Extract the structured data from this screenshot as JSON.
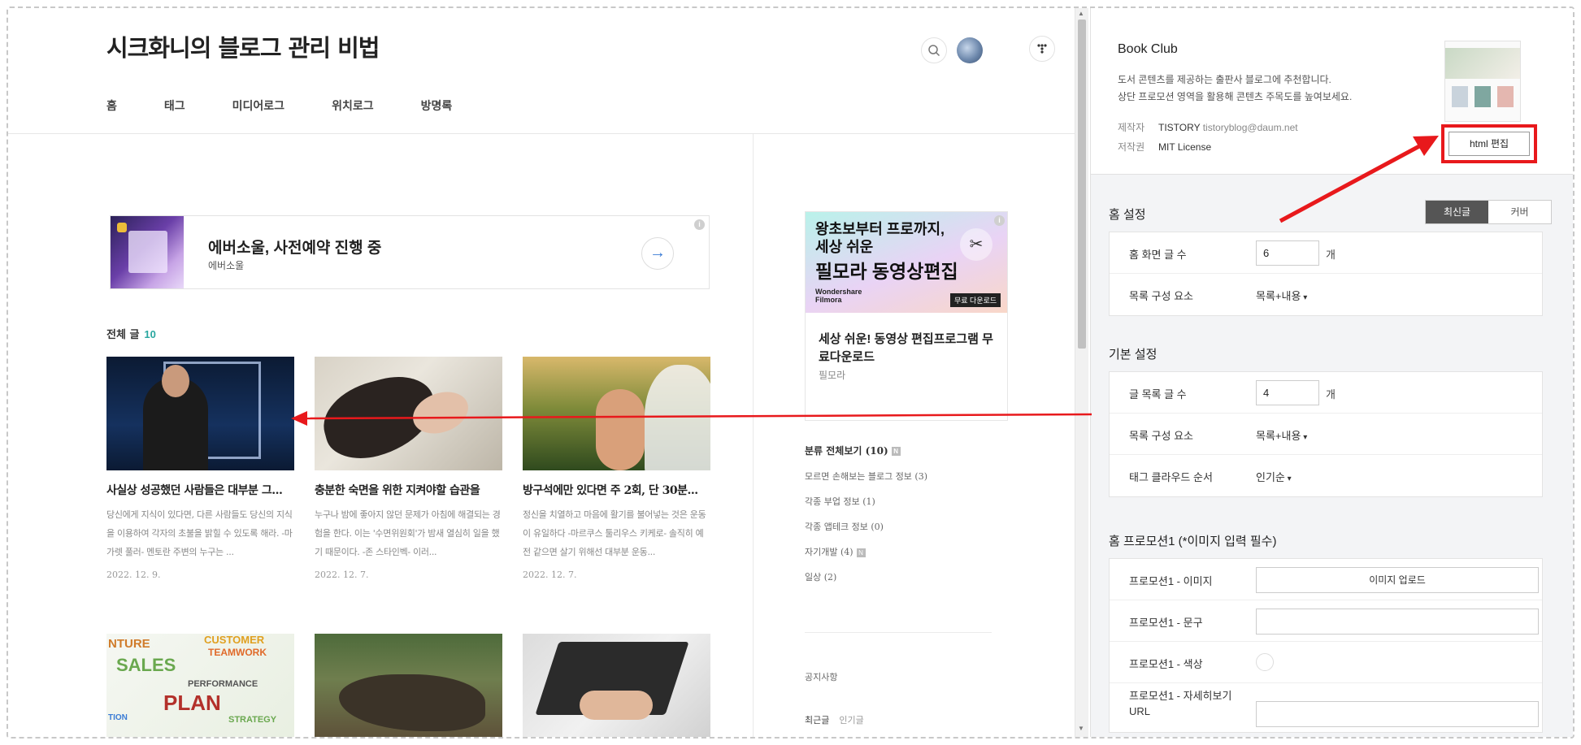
{
  "blog": {
    "title": "시크화니의 블로그 관리 비법",
    "nav": [
      "홈",
      "태그",
      "미디어로그",
      "위치로그",
      "방명록"
    ]
  },
  "banner_ad": {
    "title": "에버소울, 사전예약 진행 중",
    "subtitle": "에버소울",
    "info": "i",
    "go": "→"
  },
  "posts_header": {
    "label": "전체 글",
    "count": "10"
  },
  "posts": [
    {
      "title": "사실상 성공했던 사람들은 대부분 그...",
      "excerpt": "당신에게 지식이 있다면, 다른 사람들도 당신의 지식을 이용하여 각자의 초불을 밝힐 수 있도록 해라. -마가렛 풀러- 멘토란 주변의 누구는 ...",
      "date": "2022. 12. 9."
    },
    {
      "title": "충분한 숙면을 위한 지켜야할 습관을",
      "excerpt": "누구나 밤에 좋아지 않던 문제가 아침에 해결되는 경험을 한다. 이는 '수면위원회'가 밤새 열심히 일을 했기 때문이다. -존 스타인벡- 이러...",
      "date": "2022. 12. 7."
    },
    {
      "title": "방구석에만 있다면 주 2회, 단 30분...",
      "excerpt": "정신을 치열하고 마음에 활기를 불어넣는 것은 운동이 유일하다 -마르쿠스 툴리우스 키케로- 솔직히 예전 같으면 살기 위해선 대부분 운동...",
      "date": "2022. 12. 7."
    },
    {
      "title": "",
      "excerpt": "",
      "date": ""
    },
    {
      "title": "",
      "excerpt": "",
      "date": ""
    },
    {
      "title": "",
      "excerpt": "",
      "date": ""
    }
  ],
  "sidebar_ad": {
    "line1": "왕초보부터 프로까지,",
    "line2": "세상 쉬운",
    "line3": "필모라 동영상편집",
    "logo": "Wondershare\nFilmora",
    "download": "무료 다운로드",
    "caption": "세상 쉬운! 동영상 편집프로그램 무료다운로드",
    "source": "필모라"
  },
  "categories": {
    "head": "분류 전체보기 (10)",
    "new_badge": "N",
    "items": [
      {
        "label": "모르면 손해보는 블로그 정보 (3)",
        "new": false
      },
      {
        "label": "각종 부업 정보 (1)",
        "new": false
      },
      {
        "label": "각종 앱테크 정보 (0)",
        "new": false
      },
      {
        "label": "자기개발 (4)",
        "new": true
      },
      {
        "label": "일상 (2)",
        "new": false
      }
    ]
  },
  "notice": "공지사항",
  "recent_tabs": {
    "recent": "최근글",
    "popular": "인기글"
  },
  "skin": {
    "name": "Book Club",
    "desc1": "도서 콘텐츠를 제공하는 출판사 블로그에 추천합니다.",
    "desc2": "상단 프로모션 영역을 활용해 콘텐츠 주목도를 높여보세요.",
    "maker_label": "제작자",
    "maker": "TISTORY",
    "maker_email": "tistoryblog@daum.net",
    "license_label": "저작권",
    "license": "MIT License",
    "html_edit": "html 편집"
  },
  "home_settings": {
    "title": "홈 설정",
    "toggle": [
      "최신글",
      "커버"
    ],
    "rows": [
      {
        "label": "홈 화면 글 수",
        "value": "6",
        "unit": "개"
      },
      {
        "label": "목록 구성 요소",
        "select": "목록+내용"
      }
    ]
  },
  "basic_settings": {
    "title": "기본 설정",
    "rows": [
      {
        "label": "글 목록 글 수",
        "value": "4",
        "unit": "개"
      },
      {
        "label": "목록 구성 요소",
        "select": "목록+내용"
      },
      {
        "label": "태그 클라우드 순서",
        "select": "인기순"
      }
    ]
  },
  "promotion": {
    "title": "홈 프로모션1 (*이미지 입력 필수)",
    "rows": [
      {
        "label": "프로모션1 - 이미지",
        "button": "이미지 업로드"
      },
      {
        "label": "프로모션1 - 문구"
      },
      {
        "label": "프로모션1 - 색상"
      },
      {
        "label": "프로모션1 - 자세히보기 URL"
      }
    ]
  },
  "colors": {
    "accent_red": "#e8191c",
    "teal": "#2aa7a0",
    "toggle_on": "#555555"
  }
}
